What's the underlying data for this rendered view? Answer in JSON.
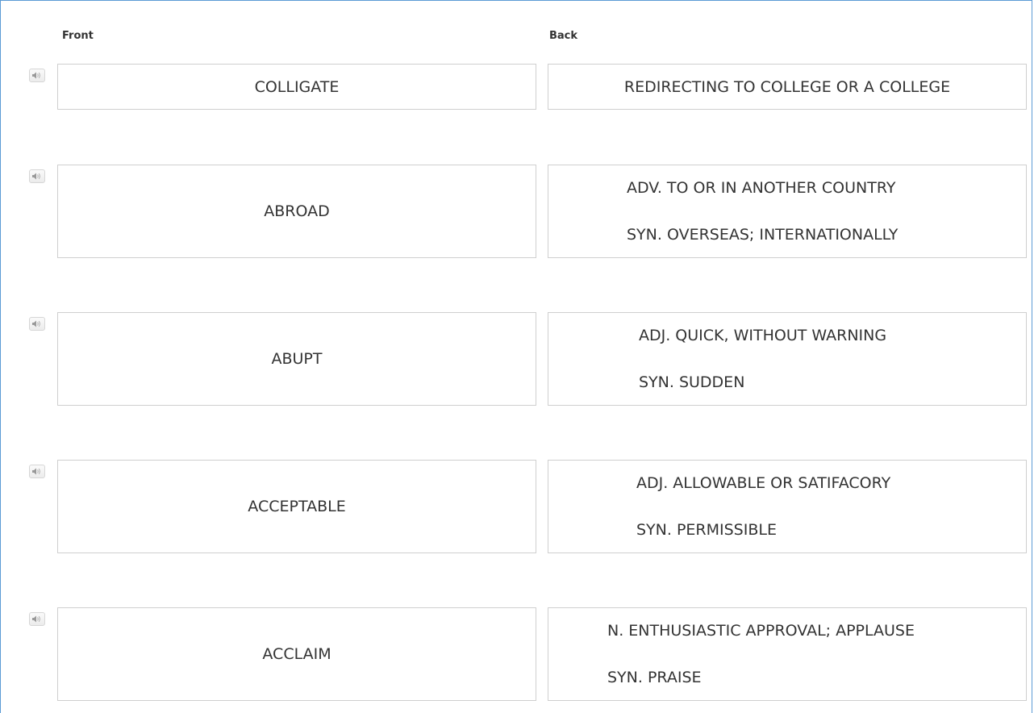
{
  "headers": {
    "front": "Front",
    "back": "Back"
  },
  "cards": [
    {
      "front": "COLLIGATE",
      "back_lines": [
        "REDIRECTING TO COLLEGE OR A COLLEGE"
      ]
    },
    {
      "front": "ABROAD",
      "back_lines": [
        "ADV. TO OR IN ANOTHER COUNTRY",
        "SYN. OVERSEAS; INTERNATIONALLY"
      ]
    },
    {
      "front": "ABUPT",
      "back_lines": [
        "ADJ. QUICK, WITHOUT WARNING",
        "SYN. SUDDEN"
      ]
    },
    {
      "front": "ACCEPTABLE",
      "back_lines": [
        "ADJ. ALLOWABLE OR SATIFACORY",
        "SYN. PERMISSIBLE"
      ]
    },
    {
      "front": "ACCLAIM",
      "back_lines": [
        "N. ENTHUSIASTIC APPROVAL; APPLAUSE",
        "SYN. PRAISE"
      ]
    }
  ],
  "icons": {
    "audio": "speaker-icon"
  },
  "colors": {
    "frame_border": "#5b9bd5",
    "card_border": "#cfcfcf",
    "text": "#333333"
  }
}
